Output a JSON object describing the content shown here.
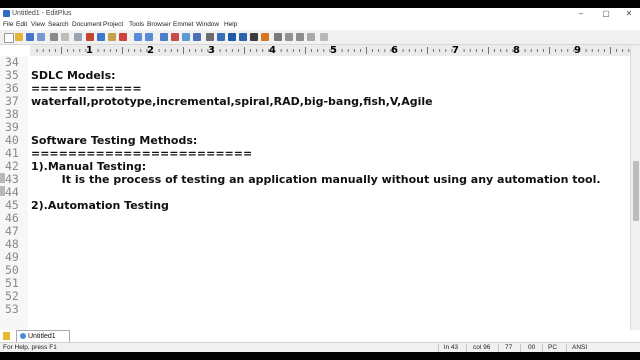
{
  "window": {
    "title": "Untitled1 - EditPlus",
    "controls": [
      "–",
      "▢",
      "✕"
    ]
  },
  "menu": [
    "File",
    "Edit",
    "View",
    "Search",
    "Document",
    "Project",
    "Tools",
    "Browser",
    "Emmet",
    "Window",
    "Help"
  ],
  "ruler": {
    "numbers": [
      "1",
      "2",
      "3",
      "4",
      "5",
      "6",
      "7",
      "8",
      "9"
    ]
  },
  "editor": {
    "lines": [
      {
        "num": "34",
        "text": ""
      },
      {
        "num": "35",
        "text": "SDLC Models:"
      },
      {
        "num": "36",
        "text": "============"
      },
      {
        "num": "37",
        "text": "waterfall,prototype,incremental,spiral,RAD,big-bang,fish,V,Agile"
      },
      {
        "num": "38",
        "text": ""
      },
      {
        "num": "39",
        "text": ""
      },
      {
        "num": "40",
        "text": "Software Testing Methods:"
      },
      {
        "num": "41",
        "text": "========================"
      },
      {
        "num": "42",
        "text": "1).Manual Testing:"
      },
      {
        "num": "43",
        "text": "        It is the process of testing an application manually without using any automation tool."
      },
      {
        "num": "44",
        "text": ""
      },
      {
        "num": "45",
        "text": "2).Automation Testing"
      },
      {
        "num": "46",
        "text": ""
      },
      {
        "num": "47",
        "text": ""
      },
      {
        "num": "48",
        "text": ""
      },
      {
        "num": "49",
        "text": ""
      },
      {
        "num": "50",
        "text": ""
      },
      {
        "num": "51",
        "text": ""
      },
      {
        "num": "52",
        "text": ""
      },
      {
        "num": "53",
        "text": ""
      }
    ]
  },
  "tabs": [
    {
      "label": "Untitled1"
    }
  ],
  "status": {
    "help": "For Help, press F1",
    "line": "ln 43",
    "col": "col 96",
    "chars": "77",
    "hex": "00",
    "eol": "PC",
    "encoding": "ANSI"
  }
}
